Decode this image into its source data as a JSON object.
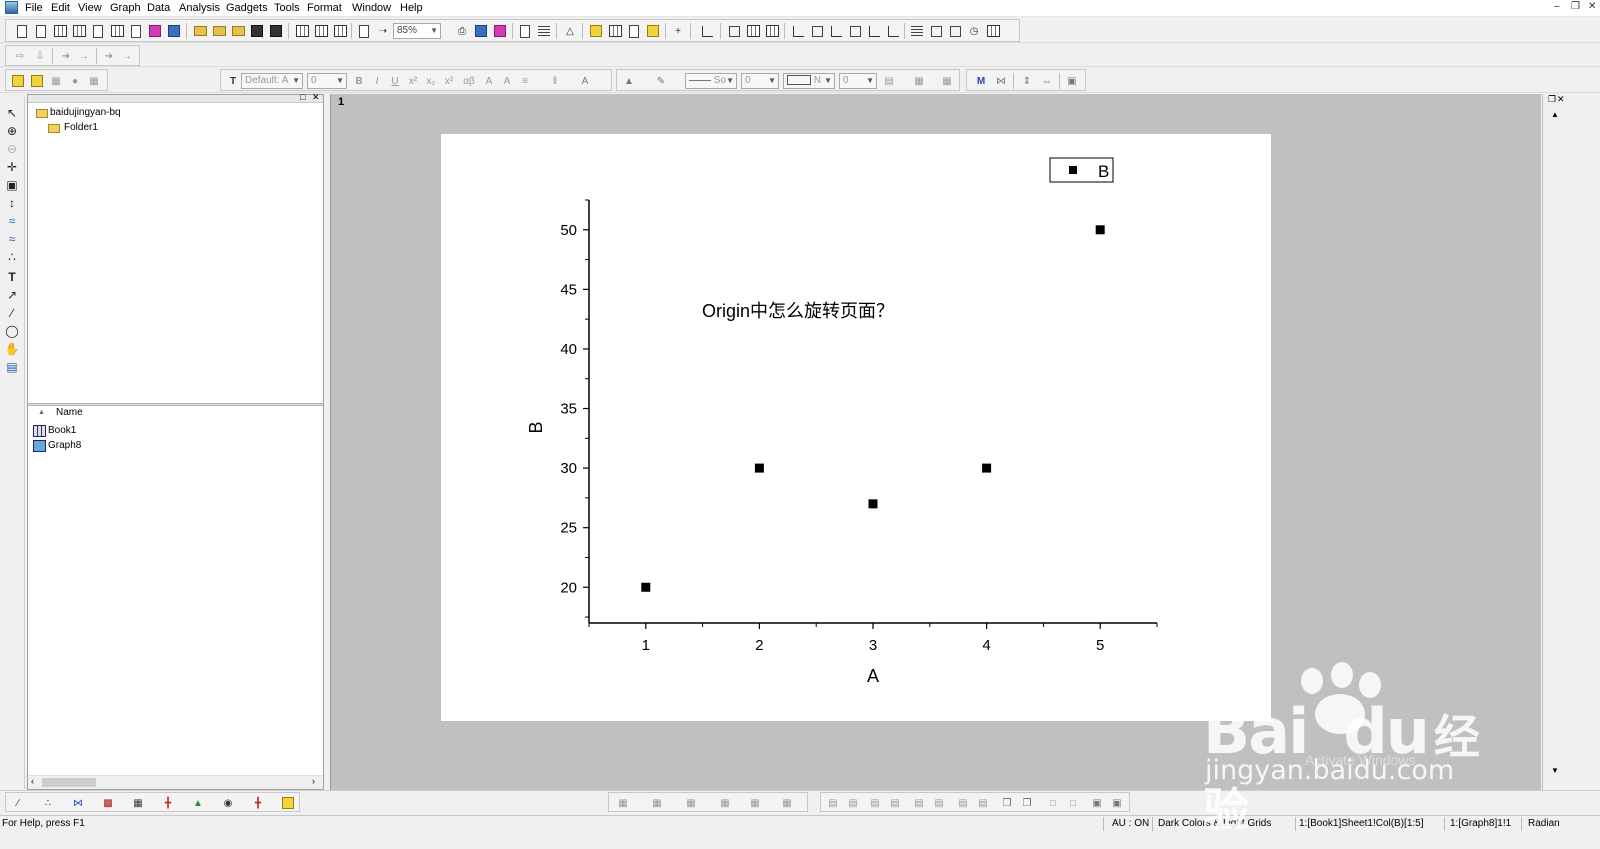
{
  "menubar": {
    "items": [
      "File",
      "Edit",
      "View",
      "Graph",
      "Data",
      "Analysis",
      "Gadgets",
      "Tools",
      "Format",
      "Window",
      "Help"
    ]
  },
  "toolbar": {
    "zoom_value": "85%",
    "font_name": "Default: A",
    "font_size": "0",
    "line_style": "So",
    "line_width": "0",
    "fill_label": "N",
    "fill_value": "0"
  },
  "project_explorer": {
    "root_folder": "baidujingyan-bq",
    "subfolder": "Folder1",
    "name_header": "Name",
    "items": [
      {
        "name": "Book1",
        "icon": "workbook-icon"
      },
      {
        "name": "Graph8",
        "icon": "graph-icon"
      }
    ]
  },
  "graph": {
    "layer_number": "1",
    "annotation": "Origin中怎么旋转页面？",
    "legend_label": "B"
  },
  "chart_data": {
    "type": "scatter",
    "x": [
      1,
      2,
      3,
      4,
      5
    ],
    "series": [
      {
        "name": "B",
        "values": [
          20,
          30,
          27,
          30,
          50
        ]
      }
    ],
    "xlabel": "A",
    "ylabel": "B",
    "xlim": [
      0.5,
      5.5
    ],
    "ylim": [
      17,
      52.5
    ],
    "xticks": [
      "1",
      "2",
      "3",
      "4",
      "5"
    ],
    "yticks": [
      "20",
      "25",
      "30",
      "35",
      "40",
      "45",
      "50"
    ],
    "legend_position": "top-right",
    "grid": false,
    "marker_color": "#000000"
  },
  "statusbar": {
    "help": "For Help, press F1",
    "au": "AU : ON",
    "theme": "Dark Colors & Light Grids",
    "active_column": "1:[Book1]Sheet1!Col(B)[1:5]",
    "active_graph": "1:[Graph8]1!1",
    "angle_unit": "Radian"
  },
  "watermark": {
    "brand": "Bai",
    "brand2": "du",
    "cn": "经验",
    "url": "jingyan.baidu.com",
    "activate": "Activate Windows"
  }
}
